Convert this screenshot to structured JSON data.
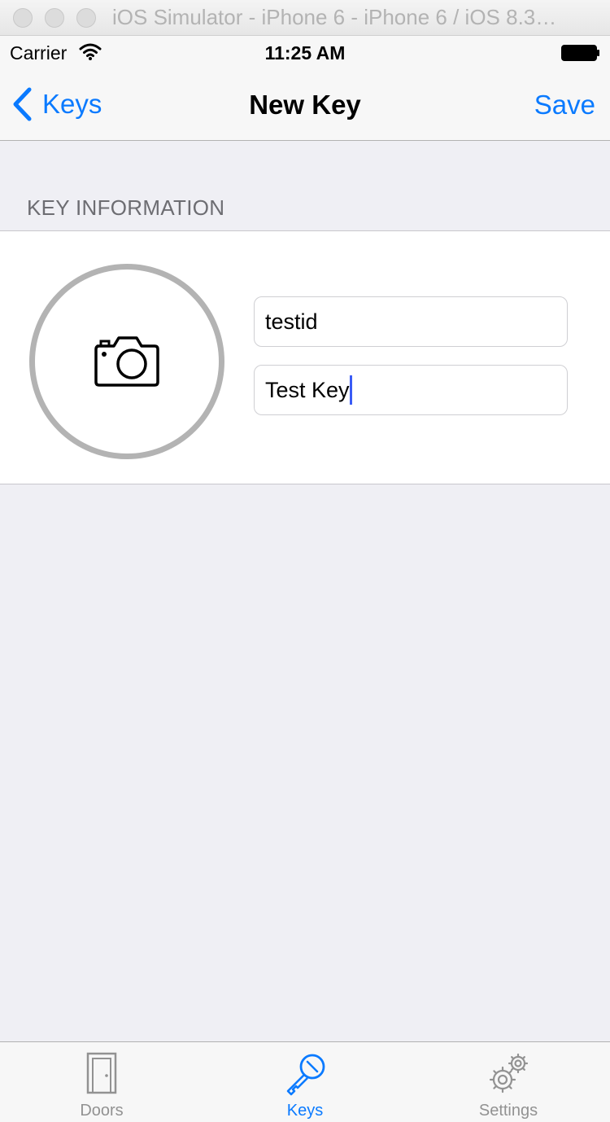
{
  "window": {
    "title": "iOS Simulator - iPhone 6 - iPhone 6 / iOS 8.3…"
  },
  "status_bar": {
    "carrier": "Carrier",
    "time": "11:25 AM"
  },
  "nav": {
    "back_label": "Keys",
    "title": "New Key",
    "save_label": "Save"
  },
  "section": {
    "header": "KEY INFORMATION"
  },
  "form": {
    "id_value": "testid",
    "name_value": "Test Key"
  },
  "tabs": [
    {
      "label": "Doors",
      "icon": "door-icon",
      "active": false
    },
    {
      "label": "Keys",
      "icon": "key-icon",
      "active": true
    },
    {
      "label": "Settings",
      "icon": "gears-icon",
      "active": false
    }
  ],
  "colors": {
    "accent": "#0a7aff",
    "inactive": "#929292",
    "background": "#efeff4"
  }
}
